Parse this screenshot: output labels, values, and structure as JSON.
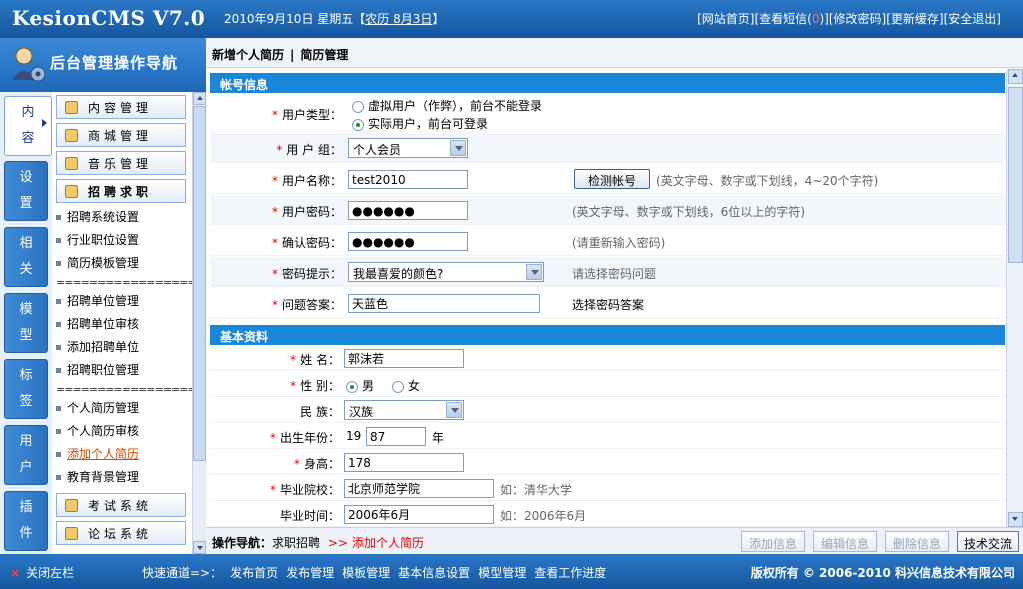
{
  "header": {
    "logo": "KesionCMS V7.0",
    "date": "2010年9月10日 星期五【",
    "lunar": "农历 8月3日",
    "date_close": "】",
    "links": [
      "[网站首页]",
      "[查看短信(",
      "0",
      ")]",
      "[修改密码]",
      "[更新缓存]",
      "[安全退出]"
    ]
  },
  "sidebar": {
    "title": "后台管理操作导航",
    "tabs": [
      "内容",
      "设置",
      "相关",
      "模型",
      "标签",
      "用户",
      "插件"
    ],
    "top_buttons": [
      "内容管理",
      "商城管理",
      "音乐管理",
      "招聘求职"
    ],
    "group1": [
      "招聘系统设置",
      "行业职位设置",
      "简历模板管理"
    ],
    "separator": "===================",
    "group2": [
      "招聘单位管理",
      "招聘单位审核",
      "添加招聘单位",
      "招聘职位管理"
    ],
    "group3": [
      "个人简历管理",
      "个人简历审核",
      "添加个人简历",
      "教育背景管理"
    ],
    "bottom_buttons": [
      "考试系统",
      "论坛系统"
    ]
  },
  "main": {
    "breadcrumb_a": "新增个人简历",
    "breadcrumb_sep": "|",
    "breadcrumb_b": "简历管理",
    "section_account": "帐号信息",
    "section_basic": "基本资料",
    "account": {
      "user_type_label": "用户类型：",
      "user_type_opt1": "虚拟用户（作弊），前台不能登录",
      "user_type_opt2": "实际用户，前台可登录",
      "group_label": "用 户 组：",
      "group_value": "个人会员",
      "username_label": "用户名称：",
      "username_value": "test2010",
      "check_button": "检测帐号",
      "username_hint": "(英文字母、数字或下划线，4~20个字符)",
      "password_label": "用户密码：",
      "password_value": "●●●●●●",
      "password_hint": "(英文字母、数字或下划线，6位以上的字符)",
      "confirm_label": "确认密码：",
      "confirm_value": "●●●●●●",
      "confirm_hint": "(请重新输入密码)",
      "question_label": "密码提示：",
      "question_value": "我最喜爱的颜色?",
      "question_hint": "请选择密码问题",
      "answer_label": "问题答案：",
      "answer_value": "天蓝色",
      "answer_hint": "选择密码答案"
    },
    "basic": {
      "name_label": "姓 名：",
      "name_value": "郭沫若",
      "gender_label": "性 别：",
      "gender_male": "男",
      "gender_female": "女",
      "nation_label": "民 族：",
      "nation_value": "汉族",
      "birth_label": "出生年份：",
      "birth_prefix": "19",
      "birth_value": "87",
      "birth_suffix": "年",
      "height_label": "身高：",
      "height_value": "178",
      "school_label": "毕业院校：",
      "school_value": "北京师范学院",
      "school_hint": "如：清华大学",
      "gradtime_label": "毕业时间：",
      "gradtime_value": "2006年6月",
      "gradtime_hint": "如：2006年6月"
    }
  },
  "actionbar": {
    "nav_label": "操作导航：",
    "nav_parent": "求职招聘",
    "nav_arrow": ">>",
    "nav_current": "添加个人简历",
    "buttons": [
      "添加信息",
      "编辑信息",
      "删除信息",
      "技术交流"
    ]
  },
  "footer": {
    "close": "关闭左栏",
    "quick_label": "快速通道=>：",
    "quick_links": [
      "发布首页",
      "发布管理",
      "模板管理",
      "基本信息设置",
      "模型管理",
      "查看工作进度"
    ],
    "copyright": "版权所有 © 2006-2010 科兴信息技术有限公司"
  }
}
